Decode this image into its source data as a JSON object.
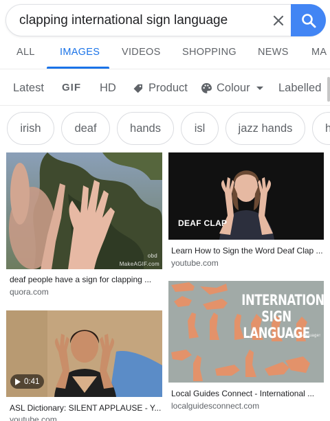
{
  "search": {
    "query": "clapping international sign language"
  },
  "tabs": [
    {
      "label": "ALL"
    },
    {
      "label": "IMAGES",
      "active": true
    },
    {
      "label": "VIDEOS"
    },
    {
      "label": "SHOPPING"
    },
    {
      "label": "NEWS"
    },
    {
      "label": "MA"
    }
  ],
  "tools": {
    "latest": "Latest",
    "gif": "GIF",
    "hd": "HD",
    "product": "Product",
    "colour": "Colour",
    "labelled": "Labelled"
  },
  "chips": [
    "irish",
    "deaf",
    "hands",
    "isl",
    "jazz hands",
    "h"
  ],
  "results": [
    {
      "caption": "deaf people have a sign for clapping ...",
      "domain": "quora.com",
      "watermark": "MakeAGIF.com",
      "watermark_small": "obd"
    },
    {
      "caption": "Learn How to Sign the Word Deaf Clap ...",
      "domain": "youtube.com",
      "overlay": "DEAF CLAP"
    },
    {
      "caption": "Local Guides Connect - International ...",
      "domain": "localguidesconnect.com",
      "overlay_line1": "INTERNATIONAL",
      "overlay_line2": "SIGN LANGUAGE",
      "overlay_small": "Sign Language!"
    },
    {
      "caption": "ASL Dictionary: SILENT APPLAUSE - Y...",
      "domain": "youtube.com",
      "duration": "0:41"
    }
  ],
  "colors": {
    "accent": "#1a73e8",
    "search_button": "#4285f4"
  }
}
